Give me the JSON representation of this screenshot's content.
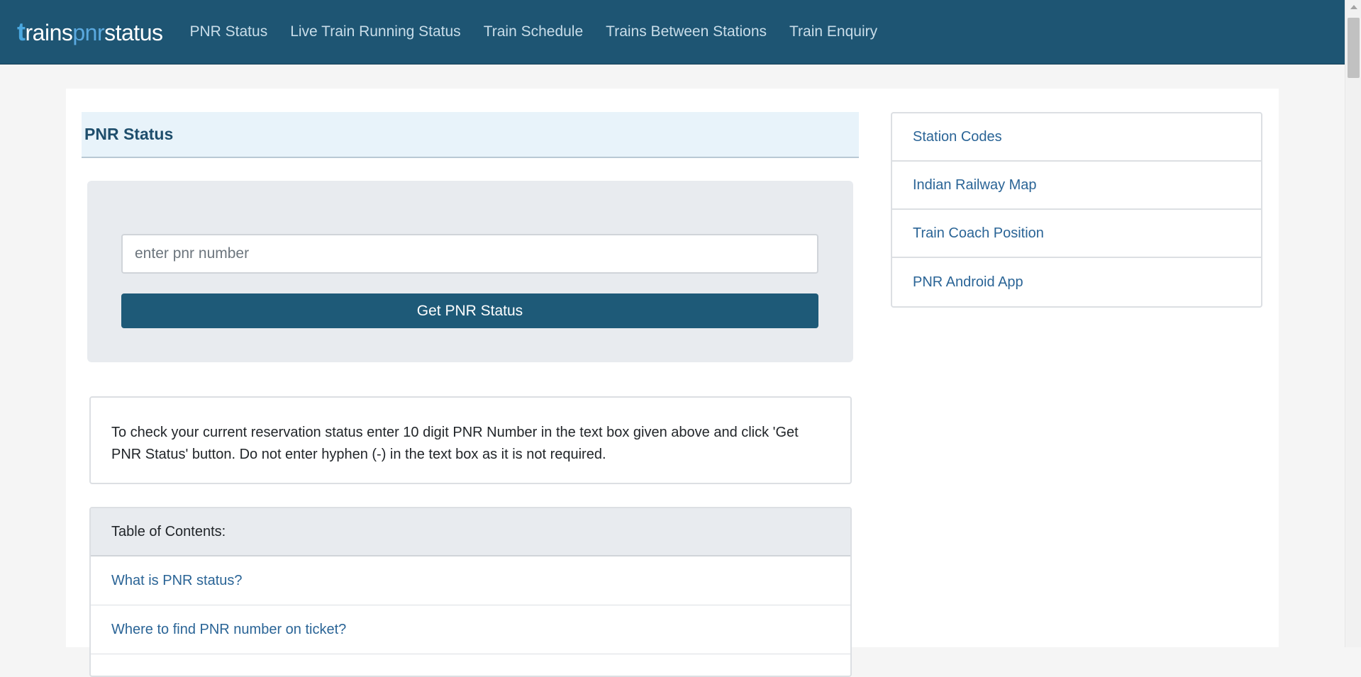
{
  "brand": {
    "first_letter": "t",
    "part1": "rains",
    "part2": "pnr",
    "part3": "status"
  },
  "nav": {
    "items": [
      {
        "label": "PNR Status"
      },
      {
        "label": "Live Train Running Status"
      },
      {
        "label": "Train Schedule"
      },
      {
        "label": "Trains Between Stations"
      },
      {
        "label": "Train Enquiry"
      }
    ]
  },
  "main": {
    "title": "PNR Status",
    "input_placeholder": "enter pnr number",
    "input_value": "",
    "button_label": "Get PNR Status",
    "info_text": "To check your current reservation status enter 10 digit PNR Number in the text box given above and click 'Get PNR Status' button. Do not enter hyphen (-) in the text box as it is not required.",
    "toc": {
      "header": "Table of Contents:",
      "items": [
        {
          "label": "What is PNR status?"
        },
        {
          "label": "Where to find PNR number on ticket?"
        }
      ]
    }
  },
  "sidebar": {
    "items": [
      {
        "label": "Station Codes"
      },
      {
        "label": "Indian Railway Map"
      },
      {
        "label": "Train Coach Position"
      },
      {
        "label": "PNR Android App"
      }
    ]
  },
  "colors": {
    "navbar": "#1e5573",
    "accent": "#1e5a78",
    "link": "#2a6496",
    "header_bg": "#e8f3fa"
  }
}
